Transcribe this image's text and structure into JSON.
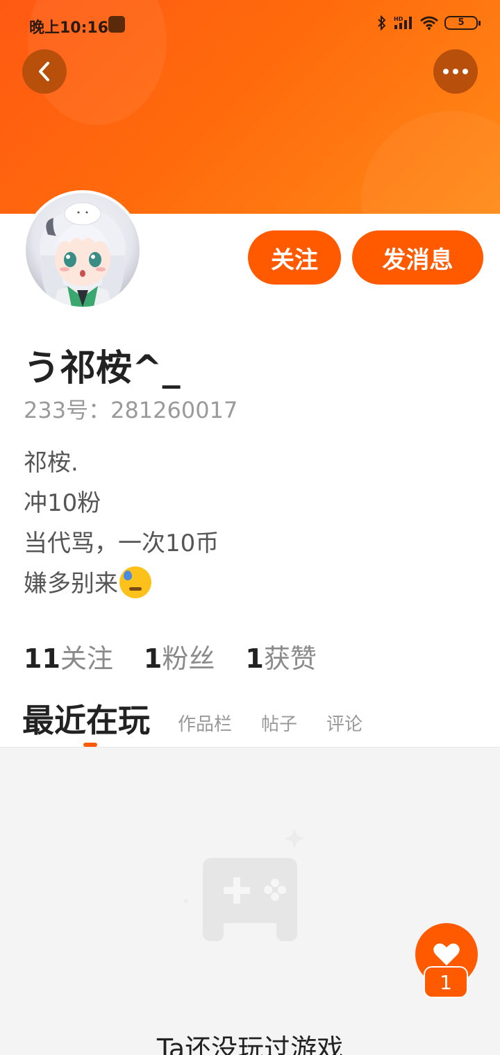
{
  "status_bar": {
    "time": "晚上10:16",
    "battery": "5",
    "icons": [
      "bluetooth-icon",
      "signal-hd-icon",
      "wifi-icon",
      "battery-icon"
    ]
  },
  "header": {
    "back_icon": "chevron-left-icon",
    "more_icon": "more-dots-icon",
    "banner_color": "#ff6a0c"
  },
  "profile": {
    "username": "う祁桉^_",
    "user_id": "233号：281260017",
    "bio_lines": [
      "祁桉.",
      "冲10粉",
      "当代骂，一次10币",
      "嫌多别来"
    ],
    "bio_emoji": "sweat-face-emoji",
    "follow_label": "关注",
    "message_label": "发消息"
  },
  "stats": [
    {
      "count": "11",
      "label": "关注"
    },
    {
      "count": "1",
      "label": "粉丝"
    },
    {
      "count": "1",
      "label": "获赞"
    }
  ],
  "tabs": [
    {
      "label": "最近在玩",
      "active": true
    },
    {
      "label": "作品栏",
      "active": false
    },
    {
      "label": "帖子",
      "active": false
    },
    {
      "label": "评论",
      "active": false
    }
  ],
  "empty_state": {
    "text": "Ta还没玩过游戏",
    "icon": "gamepad-icon"
  },
  "like_fab": {
    "icon": "heart-icon",
    "count": "1"
  },
  "colors": {
    "accent": "#ff5a00",
    "text_primary": "#222222",
    "text_secondary": "#9a9a9a",
    "content_bg": "#f4f4f4"
  }
}
